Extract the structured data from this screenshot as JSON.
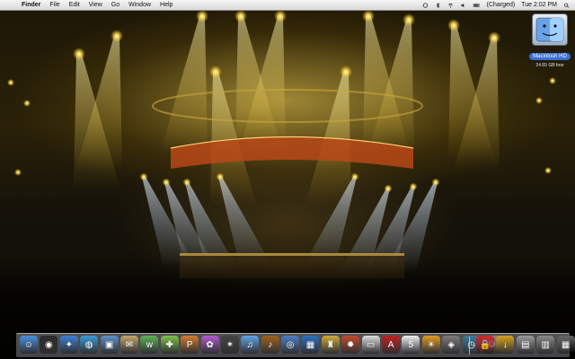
{
  "menubar": {
    "apple": "",
    "app_name": "Finder",
    "menus": [
      "File",
      "Edit",
      "View",
      "Go",
      "Window",
      "Help"
    ],
    "battery": "(Charged)",
    "clock": "Tue 2:02 PM"
  },
  "desktop_icons": [
    {
      "label": "Macintosh HD",
      "subtitle": "24.65 GB free",
      "icon": "hard-drive-icon"
    }
  ],
  "dock": {
    "apps": [
      {
        "name": "finder-icon",
        "color": "#4a8fe0",
        "glyph": "☺"
      },
      {
        "name": "dashboard-icon",
        "color": "#2b2b2b",
        "glyph": "◉"
      },
      {
        "name": "safari-icon",
        "color": "#3b7fd8",
        "glyph": "✦"
      },
      {
        "name": "globe-icon",
        "color": "#3a9ad9",
        "glyph": "◍"
      },
      {
        "name": "preview-icon",
        "color": "#5c8fc9",
        "glyph": "▣"
      },
      {
        "name": "paper-icon",
        "color": "#c4a46a",
        "glyph": "✉"
      },
      {
        "name": "ichat-icon",
        "color": "#5fb05a",
        "glyph": "w"
      },
      {
        "name": "puzzle-icon",
        "color": "#7ec24a",
        "glyph": "✚"
      },
      {
        "name": "p-app-icon",
        "color": "#d27a2f",
        "glyph": "P"
      },
      {
        "name": "photo-icon",
        "color": "#b05ad0",
        "glyph": "✿"
      },
      {
        "name": "star-icon",
        "color": "#444444",
        "glyph": "✶"
      },
      {
        "name": "itunes-icon",
        "color": "#5fa4e8",
        "glyph": "♫"
      },
      {
        "name": "guitar-icon",
        "color": "#a0621f",
        "glyph": "♪"
      },
      {
        "name": "camera-icon",
        "color": "#4e7ec4",
        "glyph": "◎"
      },
      {
        "name": "iphoto-icon",
        "color": "#2c6fbf",
        "glyph": "▦"
      },
      {
        "name": "chess-icon",
        "color": "#d0a93a",
        "glyph": "♜"
      },
      {
        "name": "game-icon",
        "color": "#c24a2a",
        "glyph": "✹"
      },
      {
        "name": "screenshot-icon",
        "color": "#dddddd",
        "glyph": "▭"
      },
      {
        "name": "acrobat-icon",
        "color": "#c02020",
        "glyph": "A"
      },
      {
        "name": "calendar-icon",
        "color": "#f0f0f0",
        "glyph": "5"
      },
      {
        "name": "sun-icon",
        "color": "#e09a20",
        "glyph": "☀"
      },
      {
        "name": "graphics-icon",
        "color": "#7a7a7a",
        "glyph": "◈"
      },
      {
        "name": "time-machine-icon",
        "color": "#3a7a9a",
        "glyph": "◷"
      },
      {
        "name": "preferences-icon",
        "color": "#888888",
        "glyph": "⚙"
      }
    ],
    "right_items": [
      {
        "name": "lock-icon",
        "color": "#d02828",
        "glyph": "🔒"
      },
      {
        "name": "downloads-stack-icon",
        "color": "#d4a020",
        "glyph": "↓"
      },
      {
        "name": "documents-stack-icon",
        "color": "#999999",
        "glyph": "▤"
      },
      {
        "name": "folder-stack-icon",
        "color": "#888888",
        "glyph": "▥"
      },
      {
        "name": "network-stack-icon",
        "color": "#666666",
        "glyph": "▦"
      },
      {
        "name": "trash-icon",
        "color": "#aaaaaa",
        "glyph": "🗑"
      }
    ]
  }
}
